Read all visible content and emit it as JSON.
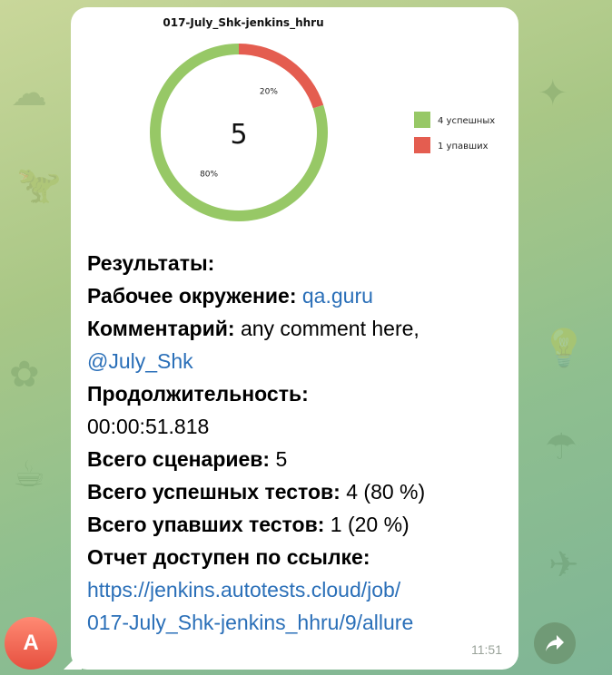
{
  "message": {
    "avatar_letter": "A",
    "time": "11:51",
    "lines": {
      "results_label": "Результаты:",
      "env_label": "Рабочее окружение:",
      "env_value": "qa.guru",
      "comment_label": "Комментарий:",
      "comment_value": "any comment here,",
      "comment_mention": "@July_Shk",
      "duration_label": "Продолжительность:",
      "duration_value": "00:00:51.818",
      "total_label": "Всего сценариев:",
      "total_value": "5",
      "passed_label": "Всего успешных тестов:",
      "passed_value": "4 (80 %)",
      "failed_label": "Всего упавших тестов:",
      "failed_value": "1 (20 %)",
      "report_label": "Отчет доступен по ссылке:",
      "report_link_line1": "https://jenkins.autotests.cloud/job/",
      "report_link_line2": "017-July_Shk-jenkins_hhru/9/allure"
    }
  },
  "chart_data": {
    "type": "pie",
    "title": "017-July_Shk-jenkins_hhru",
    "center_text": "5",
    "series": [
      {
        "name": "4 успешных",
        "value": 4,
        "label": "80%",
        "color": "#97c866"
      },
      {
        "name": "1 упавших",
        "value": 1,
        "label": "20%",
        "color": "#e45d50"
      }
    ],
    "legend_position": "right",
    "donut": true
  },
  "icons": {
    "share": "share-arrow-icon"
  }
}
